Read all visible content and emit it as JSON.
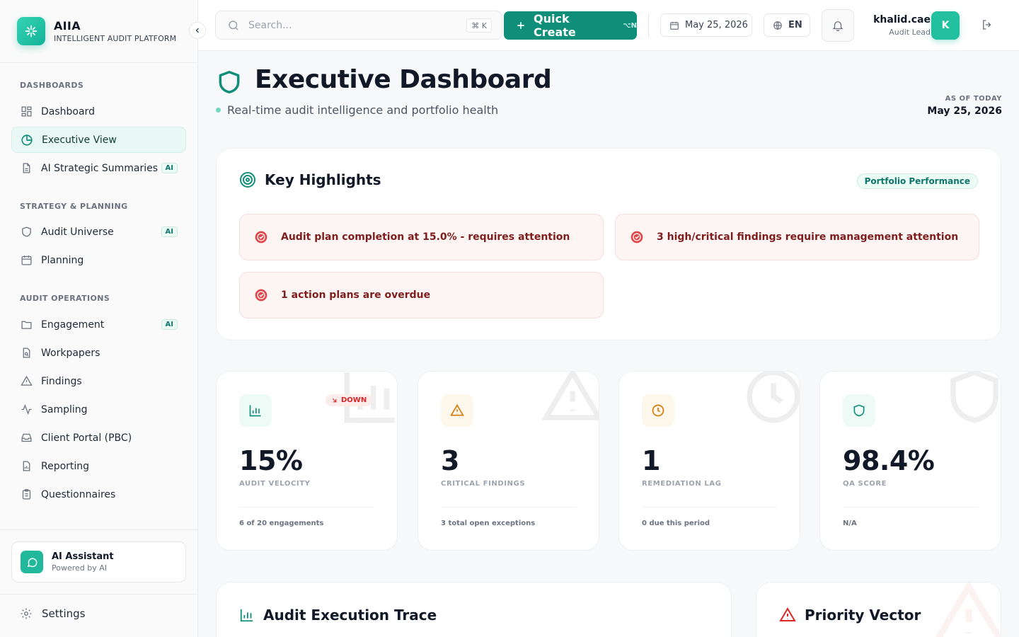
{
  "brand": {
    "name": "AIIA",
    "subtitle": "INTELLIGENT AUDIT PLATFORM"
  },
  "sidebar": {
    "sections": [
      {
        "label": "DASHBOARDS"
      },
      {
        "label": "STRATEGY & PLANNING"
      },
      {
        "label": "AUDIT OPERATIONS"
      }
    ],
    "items": [
      {
        "label": "Dashboard",
        "icon": "grid-icon",
        "active": false
      },
      {
        "label": "Executive View",
        "icon": "pie-chart-icon",
        "active": true
      },
      {
        "label": "AI Strategic Summaries",
        "icon": "document-icon",
        "badge": "AI"
      },
      {
        "label": "Audit Universe",
        "icon": "shield-icon",
        "badge": "AI"
      },
      {
        "label": "Planning",
        "icon": "calendar-icon"
      },
      {
        "label": "Engagement",
        "icon": "folder-icon",
        "badge": "AI"
      },
      {
        "label": "Workpapers",
        "icon": "file-search-icon"
      },
      {
        "label": "Findings",
        "icon": "warning-icon"
      },
      {
        "label": "Sampling",
        "icon": "activity-icon"
      },
      {
        "label": "Client Portal (PBC)",
        "icon": "inbox-icon"
      },
      {
        "label": "Reporting",
        "icon": "report-icon"
      },
      {
        "label": "Questionnaires",
        "icon": "clipboard-icon"
      }
    ],
    "assistant": {
      "title": "AI Assistant",
      "subtitle": "Powered by AI"
    },
    "settings": "Settings"
  },
  "topbar": {
    "search_placeholder": "Search...",
    "search_kbd": "⌘ K",
    "quick_create": "Quick Create",
    "quick_create_kbd": "⌥N",
    "date": "May 25, 2026",
    "language": "EN",
    "user": {
      "name": "khalid.cae",
      "role": "Audit Lead",
      "initial": "K"
    }
  },
  "header": {
    "title": "Executive Dashboard",
    "subtitle": "Real-time audit intelligence and portfolio health",
    "as_of_label": "AS OF TODAY",
    "as_of_date": "May 25, 2026"
  },
  "highlights": {
    "title": "Key Highlights",
    "pill": "Portfolio Performance",
    "alerts": [
      "Audit plan completion at 15.0% - requires attention",
      "3 high/critical findings require management attention",
      "1 action plans are overdue"
    ]
  },
  "kpis": [
    {
      "value": "15%",
      "label": "AUDIT VELOCITY",
      "footer": "6 of 20 engagements",
      "trend": "DOWN",
      "icon": "bar-chart-icon"
    },
    {
      "value": "3",
      "label": "CRITICAL FINDINGS",
      "footer": "3 total open exceptions",
      "icon": "warning-icon"
    },
    {
      "value": "1",
      "label": "REMEDIATION LAG",
      "footer": "0 due this period",
      "icon": "clock-icon"
    },
    {
      "value": "98.4%",
      "label": "QA SCORE",
      "footer": "N/A",
      "icon": "shield-icon"
    }
  ],
  "panels": [
    {
      "title": "Audit Execution Trace"
    },
    {
      "title": "Priority Vector"
    }
  ],
  "colors": {
    "accent": "#0f8f7a",
    "accent_light": "#22c09f",
    "danger": "#dc2626",
    "warning": "#d97706"
  }
}
